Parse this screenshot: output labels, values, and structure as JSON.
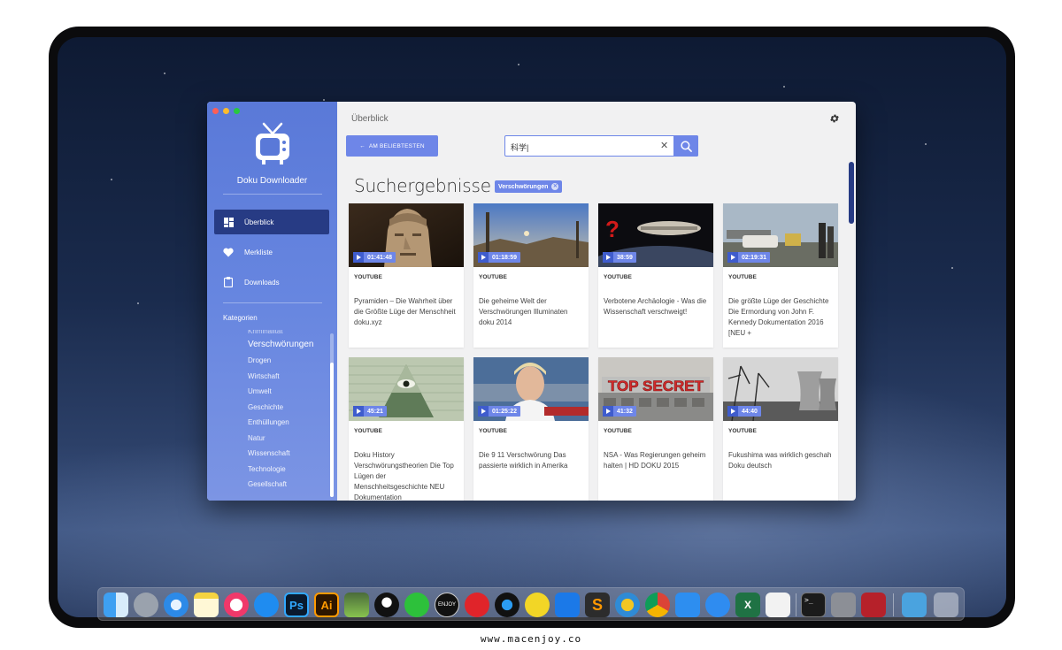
{
  "sidebar": {
    "app_name": "Doku Downloader",
    "nav": [
      {
        "label": "Überblick",
        "icon": "dashboard-icon",
        "active": true
      },
      {
        "label": "Merkliste",
        "icon": "heart-icon",
        "active": false
      },
      {
        "label": "Downloads",
        "icon": "clipboard-icon",
        "active": false
      }
    ],
    "categories_title": "Kategorien",
    "categories": [
      "Kriminalität",
      "Verschwörungen",
      "Drogen",
      "Wirtschaft",
      "Umwelt",
      "Geschichte",
      "Enthüllungen",
      "Natur",
      "Wissenschaft",
      "Technologie",
      "Gesellschaft"
    ]
  },
  "main": {
    "title": "Überblick",
    "back_button": "AM BELIEBTESTEN",
    "search": {
      "value": "科学|"
    },
    "results_heading": "Suchergebnisse :",
    "filter_chip": "Verschwörungen",
    "videos": [
      {
        "duration": "01:41:48",
        "source": "YOUTUBE",
        "title": "Pyramiden – Die Wahrheit über die Größte Lüge der Menschheit doku.xyz"
      },
      {
        "duration": "01:18:59",
        "source": "YOUTUBE",
        "title": "Die geheime Welt der Verschwörungen Illuminaten doku 2014"
      },
      {
        "duration": "38:59",
        "source": "YOUTUBE",
        "title": "Verbotene Archäologie - Was die Wissenschaft verschweigt!"
      },
      {
        "duration": "02:19:31",
        "source": "YOUTUBE",
        "title": "Die größte Lüge der Geschichte Die Ermordung von John F. Kennedy Dokumentation 2016 [NEU +"
      },
      {
        "duration": "45:21",
        "source": "YOUTUBE",
        "title": "Doku History Verschwörungstheorien Die Top Lügen der Menschheitsgeschichte NEU Dokumentation"
      },
      {
        "duration": "01:25:22",
        "source": "YOUTUBE",
        "title": "Die 9 11 Verschwörung Das passierte wirklich in Amerika"
      },
      {
        "duration": "41:32",
        "source": "YOUTUBE",
        "title": "NSA - Was Regierungen geheim halten | HD DOKU 2015"
      },
      {
        "duration": "44:40",
        "source": "YOUTUBE",
        "title": "Fukushima was wirklich geschah Doku deutsch"
      }
    ],
    "thumb_texts": {
      "top_secret": "TOP SECRET",
      "question": "?"
    }
  },
  "dock": {
    "apps": [
      "finder-icon",
      "launchpad-icon",
      "safari-icon",
      "notes-icon",
      "music-icon",
      "appstore-icon",
      "photoshop-icon",
      "illustrator-icon",
      "downloader-icon",
      "qq-icon",
      "wechat-icon",
      "enjoy-icon",
      "netease-icon",
      "player-icon",
      "music2-icon",
      "teamviewer-icon",
      "sublime-icon",
      "network-icon",
      "chrome-icon",
      "transfer-icon",
      "cloud-icon",
      "excel-icon",
      "pages-icon",
      "terminal-icon",
      "preview-icon",
      "tools-icon",
      "folder-icon",
      "trash-icon"
    ],
    "ps_label": "Ps",
    "ai_label": "Ai",
    "enjoy_label": "ENJOY",
    "x_label": "X",
    "terminal_label": ">_"
  },
  "footer": "www.macenjoy.co"
}
